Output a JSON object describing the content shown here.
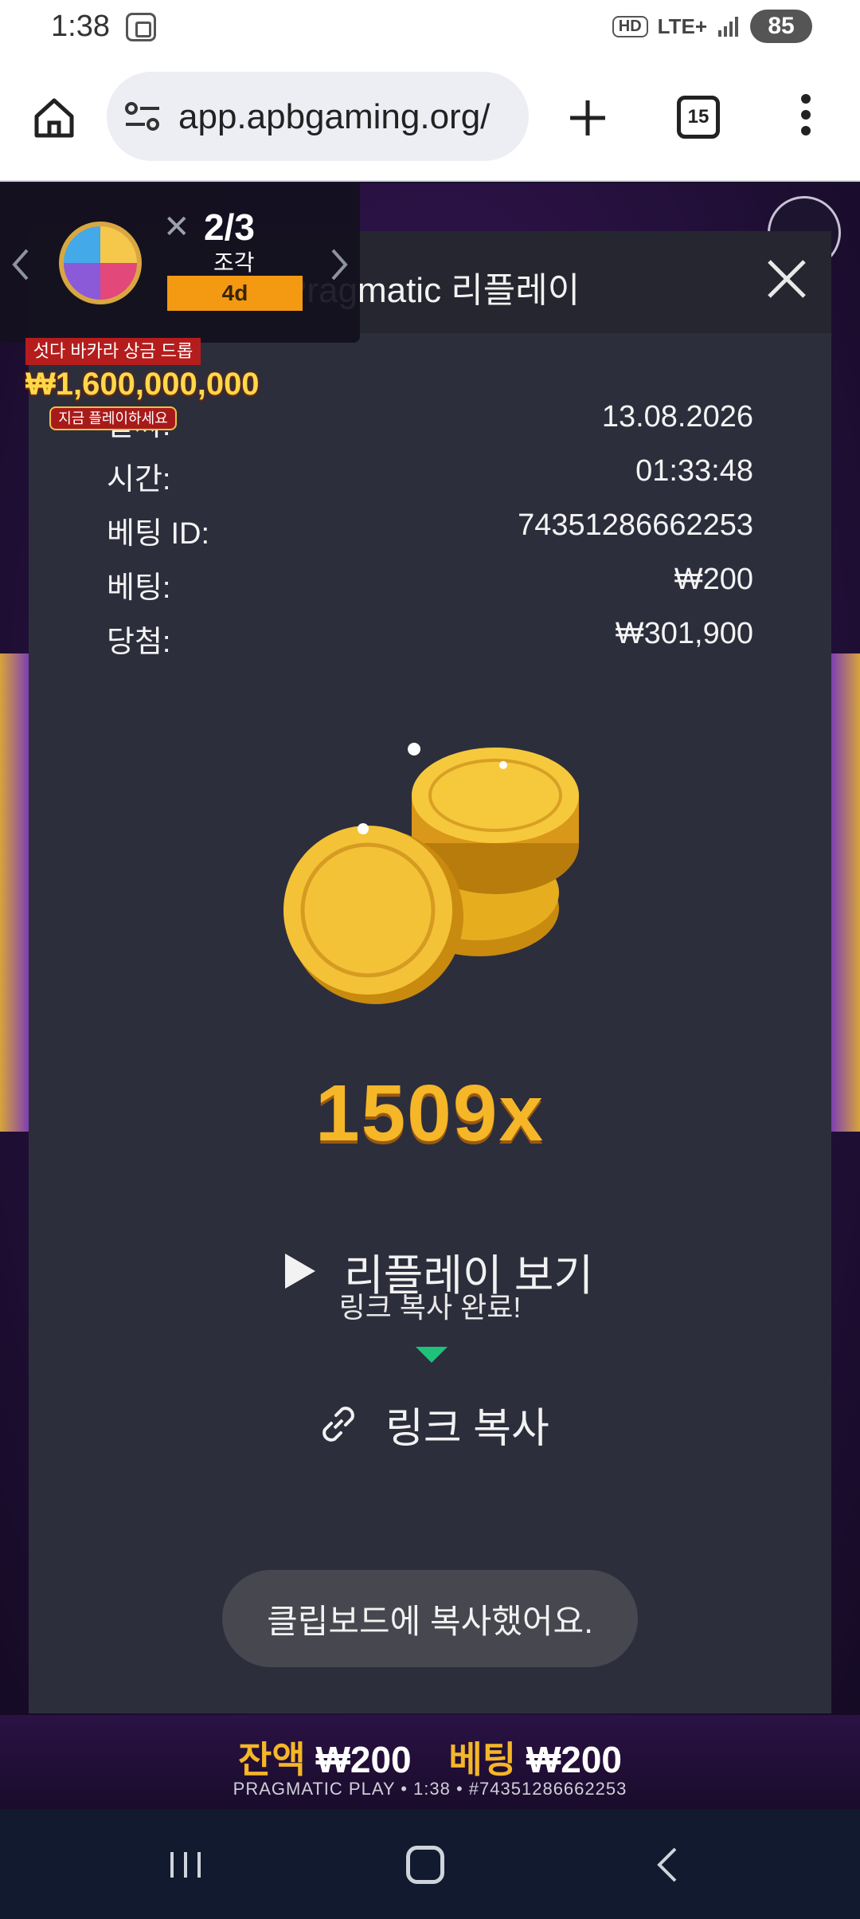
{
  "status_bar": {
    "time": "1:38",
    "hd": "HD",
    "network": "LTE+",
    "battery": "85"
  },
  "browser": {
    "url": "app.apbgaming.org/",
    "tab_count": "15"
  },
  "promo": {
    "progress": "2/3",
    "unit": "조각",
    "days_left": "4d",
    "drop_title": "섯다 바카라 상금 드롭",
    "amount": "₩1,600,000,000",
    "cta": "지금 플레이하세요"
  },
  "modal": {
    "title": "Pragmatic 리플레이",
    "rows": [
      {
        "label": "날짜:",
        "value": "13.08.2026"
      },
      {
        "label": "시간:",
        "value": "01:33:48"
      },
      {
        "label": "베팅 ID:",
        "value": "74351286662253"
      },
      {
        "label": "베팅:",
        "value": "₩200"
      },
      {
        "label": "당첨:",
        "value": "₩301,900"
      }
    ],
    "multiplier": "1509x",
    "replay_label": "리플레이 보기",
    "copied_label": "링크 복사 완료!",
    "copy_label": "링크 복사",
    "toast": "클립보드에 복사했어요."
  },
  "game_bar": {
    "balance_label": "잔액",
    "balance_value": "₩200",
    "bet_label": "베팅",
    "bet_value": "₩200",
    "provider_line": "PRAGMATIC PLAY • 1:38 • #74351286662253"
  },
  "colors": {
    "accent_gold": "#f5b628",
    "modal_bg": "#2d2e3c",
    "tooltip_green": "#1fc27a"
  }
}
